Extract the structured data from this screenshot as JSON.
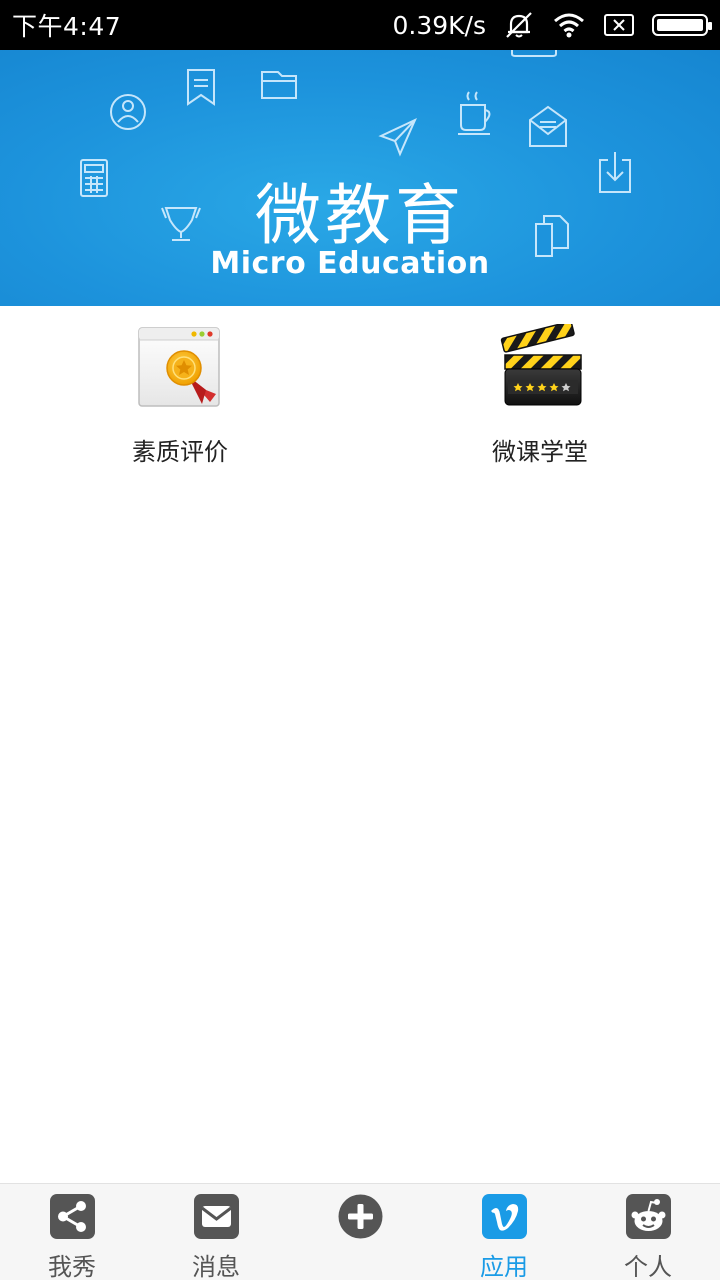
{
  "status_bar": {
    "time": "下午4:47",
    "net_speed": "0.39K/s",
    "icons": [
      "mute-icon",
      "wifi-icon",
      "no-sim-icon",
      "battery-icon"
    ]
  },
  "banner": {
    "title": "微教育",
    "subtitle": "Micro Education",
    "background": "#1d93dc"
  },
  "apps": [
    {
      "label": "素质评价",
      "icon": "award-certificate-icon"
    },
    {
      "label": "微课学堂",
      "icon": "clapperboard-icon"
    }
  ],
  "bottom_nav": {
    "active_index": 3,
    "active_color": "#1a9be6",
    "items": [
      {
        "label": "我秀",
        "icon": "share-icon"
      },
      {
        "label": "消息",
        "icon": "mail-icon"
      },
      {
        "label": "",
        "icon": "plus-icon"
      },
      {
        "label": "应用",
        "icon": "vimeo-icon"
      },
      {
        "label": "个人",
        "icon": "reddit-alien-icon"
      }
    ]
  }
}
